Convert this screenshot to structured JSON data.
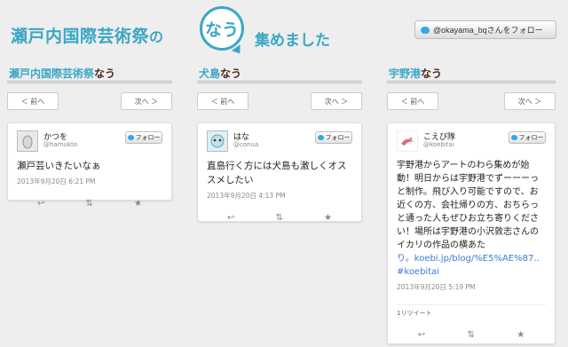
{
  "header": {
    "title_left": "瀬戸内国際芸術祭",
    "title_no": "の",
    "now": "なう",
    "title_right": "集めました",
    "follow_button": "@okayama_bqさんをフォロー"
  },
  "nav": {
    "prev": "＜ 前へ",
    "next": "次へ ＞"
  },
  "columns": [
    {
      "head_main": "瀬戸内国際芸術祭",
      "head_rest": "なう",
      "tweet": {
        "name": "かつを",
        "handle": "@hamukto",
        "follow": "フォロー",
        "text": "瀬戸芸いきたいなぁ",
        "time": "2013年9月20日 6:21 PM"
      }
    },
    {
      "head_main": "犬島",
      "head_rest": "なう",
      "tweet": {
        "name": "はな",
        "handle": "@conua",
        "follow": "フォロー",
        "text": "直島行く方には犬島も激しくオススメしたい",
        "time": "2013年9月20日 4:13 PM"
      }
    },
    {
      "head_main": "宇野港",
      "head_rest": "なう",
      "tweet": {
        "name": "こえび隊",
        "handle": "@koebitai",
        "follow": "フォロー",
        "text": "宇野港からアートのわら集めが始動！明日からは宇野港でずーーーっと制作。飛び入り可能ですので、お近くの方、会社帰りの方、おちらっと通った人もぜひお立ち寄りください！場所は宇野港の小沢敦志さんのイカリの作品の横あた",
        "link": "り。koebi.jp/blog/%E5%AE%87.. #koebitai",
        "time": "2013年9月20日 5:19 PM",
        "retweets": "1リツイート"
      }
    }
  ],
  "icons": {
    "reply": "reply-icon",
    "retweet": "retweet-icon",
    "favorite": "star-icon"
  },
  "colors": {
    "accent": "#3aa7c4",
    "twitter": "#33a7e6"
  }
}
